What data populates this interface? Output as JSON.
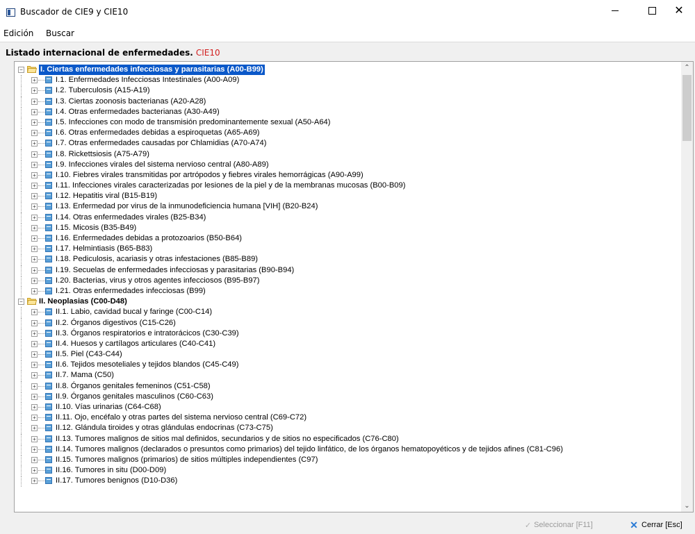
{
  "window": {
    "title": "Buscador de CIE9 y CIE10",
    "controls": {
      "minimize": "—",
      "maximize": "☐",
      "close": "✕"
    }
  },
  "menu": {
    "items": [
      "Edición",
      "Buscar"
    ]
  },
  "heading": {
    "label": "Listado internacional de enfermedades.",
    "code": "CIE10"
  },
  "tree": [
    {
      "level": 0,
      "text": "I. Ciertas enfermedades infecciosas y parasitarias (A00-B99)",
      "selected": true
    },
    {
      "level": 1,
      "text": "I.1. Enfermedades Infecciosas Intestinales (A00-A09)"
    },
    {
      "level": 1,
      "text": "I.2. Tuberculosis (A15-A19)"
    },
    {
      "level": 1,
      "text": "I.3. Ciertas zoonosis bacterianas (A20-A28)"
    },
    {
      "level": 1,
      "text": "I.4. Otras enfermedades bacterianas (A30-A49)"
    },
    {
      "level": 1,
      "text": "I.5. Infecciones con modo de transmisión predominantemente sexual (A50-A64)"
    },
    {
      "level": 1,
      "text": "I.6. Otras enfermedades debidas a espiroquetas (A65-A69)"
    },
    {
      "level": 1,
      "text": "I.7. Otras enfermedades causadas por Chlamidias (A70-A74)"
    },
    {
      "level": 1,
      "text": "I.8. Rickettsiosis (A75-A79)"
    },
    {
      "level": 1,
      "text": "I.9. Infecciones virales del sistema nervioso central (A80-A89)"
    },
    {
      "level": 1,
      "text": "I.10. Fiebres virales transmitidas por artrópodos y fiebres virales hemorrágicas (A90-A99)"
    },
    {
      "level": 1,
      "text": "I.11. Infecciones virales caracterizadas por lesiones de la piel y de la membranas mucosas (B00-B09)"
    },
    {
      "level": 1,
      "text": "I.12. Hepatitis viral (B15-B19)"
    },
    {
      "level": 1,
      "text": "I.13. Enfermedad por virus de la inmunodeficiencia humana [VIH] (B20-B24)"
    },
    {
      "level": 1,
      "text": "I.14. Otras enfermedades virales (B25-B34)"
    },
    {
      "level": 1,
      "text": "I.15. Micosis (B35-B49)"
    },
    {
      "level": 1,
      "text": "I.16. Enfermedades debidas a protozoarios (B50-B64)"
    },
    {
      "level": 1,
      "text": "I.17. Helmintiasis (B65-B83)"
    },
    {
      "level": 1,
      "text": "I.18. Pediculosis, acariasis y otras infestaciones (B85-B89)"
    },
    {
      "level": 1,
      "text": "I.19. Secuelas de enfermedades infecciosas y parasitarias (B90-B94)"
    },
    {
      "level": 1,
      "text": "I.20. Bacterias, virus y otros agentes infecciosos (B95-B97)"
    },
    {
      "level": 1,
      "text": "I.21. Otras enfermedades infecciosas (B99)"
    },
    {
      "level": 0,
      "text": "II. Neoplasias (C00-D48)"
    },
    {
      "level": 1,
      "text": "II.1. Labio, cavidad bucal y faringe (C00-C14)"
    },
    {
      "level": 1,
      "text": "II.2. Órganos digestivos (C15-C26)"
    },
    {
      "level": 1,
      "text": "II.3. Órganos respiratorios e intratorácicos (C30-C39)"
    },
    {
      "level": 1,
      "text": "II.4. Huesos y cartílagos articulares (C40-C41)"
    },
    {
      "level": 1,
      "text": "II.5. Piel (C43-C44)"
    },
    {
      "level": 1,
      "text": "II.6. Tejidos mesoteliales y tejidos blandos (C45-C49)"
    },
    {
      "level": 1,
      "text": "II.7. Mama (C50)"
    },
    {
      "level": 1,
      "text": "II.8. Órganos genitales femeninos (C51-C58)"
    },
    {
      "level": 1,
      "text": "II.9. Órganos genitales masculinos (C60-C63)"
    },
    {
      "level": 1,
      "text": "II.10. Vías urinarias (C64-C68)"
    },
    {
      "level": 1,
      "text": "II.11. Ojo, encéfalo y otras partes del sistema nervioso central (C69-C72)"
    },
    {
      "level": 1,
      "text": "II.12. Glándula tiroides y otras glándulas endocrinas (C73-C75)"
    },
    {
      "level": 1,
      "text": "II.13. Tumores malignos de sitios mal definidos, secundarios y de sitios no especificados (C76-C80)"
    },
    {
      "level": 1,
      "text": "II.14. Tumores malignos (declarados o presuntos como primarios) del tejido linfático, de los órganos hematopoyéticos y de tejidos afines (C81-C96)"
    },
    {
      "level": 1,
      "text": "II.15. Tumores malignos (primarios) de sitios múltiples independientes (C97)"
    },
    {
      "level": 1,
      "text": "II.16. Tumores in situ (D00-D09)"
    },
    {
      "level": 1,
      "text": "II.17. Tumores benignos (D10-D36)"
    }
  ],
  "buttons": {
    "select": "Seleccionar [F11]",
    "close": "Cerrar [Esc]"
  },
  "colors": {
    "selection": "#0a58c9",
    "accent_red": "#d21f1f"
  }
}
